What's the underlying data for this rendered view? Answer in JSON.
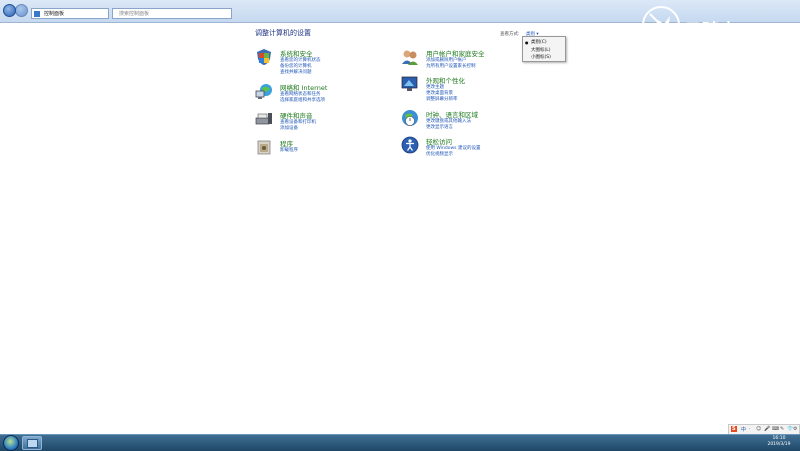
{
  "address": {
    "path": "控制面板",
    "search_placeholder": "搜索控制面板"
  },
  "main": {
    "title": "调整计算机的设置",
    "view_label": "查看方式:",
    "view_value": "类别 ▾",
    "view_menu": [
      "类别(C)",
      "大图标(L)",
      "小图标(S)"
    ]
  },
  "categories": [
    {
      "title": "系统和安全",
      "links": [
        "查看您的计算机状态",
        "备份您的计算机",
        "查找并解决问题"
      ],
      "icon": "system-security-icon"
    },
    {
      "title": "网络和 Internet",
      "links": [
        "查看网络状态和任务",
        "选择家庭组和共享选项"
      ],
      "icon": "network-icon"
    },
    {
      "title": "硬件和声音",
      "links": [
        "查看设备和打印机",
        "添加设备"
      ],
      "icon": "hardware-sound-icon"
    },
    {
      "title": "程序",
      "links": [
        "卸载程序"
      ],
      "icon": "programs-icon"
    },
    {
      "title": "用户帐户和家庭安全",
      "links": [
        "添加或删除用户帐户",
        "为所有用户设置家长控制"
      ],
      "icon": "user-accounts-icon"
    },
    {
      "title": "外观和个性化",
      "links": [
        "更改主题",
        "更改桌面背景",
        "调整屏幕分辨率"
      ],
      "icon": "appearance-icon"
    },
    {
      "title": "时钟、语言和区域",
      "links": [
        "更改键盘或其他输入法",
        "更改显示语言"
      ],
      "icon": "clock-language-icon"
    },
    {
      "title": "轻松访问",
      "links": [
        "使用 Windows 建议的设置",
        "优化视频显示"
      ],
      "icon": "ease-of-access-icon"
    }
  ],
  "taskbar": {
    "time": "16:10",
    "date": "2019/3/19",
    "ime": [
      "S",
      "中",
      "·",
      "☺",
      "🎤",
      "⌨",
      "✎",
      "👕",
      "⚙"
    ]
  },
  "watermark": {
    "text": "云骑士"
  }
}
